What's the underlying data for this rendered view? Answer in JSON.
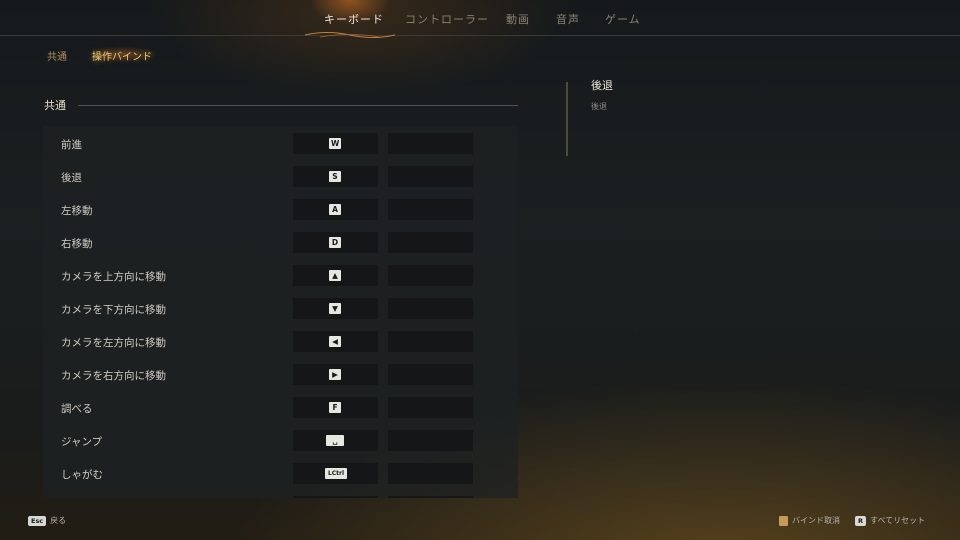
{
  "topnav": {
    "tabs": [
      {
        "label": "キーボード",
        "active": true
      },
      {
        "label": "コントローラー",
        "active": false
      },
      {
        "label": "動画",
        "active": false
      },
      {
        "label": "音声",
        "active": false
      },
      {
        "label": "ゲーム",
        "active": false
      }
    ]
  },
  "subtabs": [
    {
      "label": "共通",
      "active": false
    },
    {
      "label": "操作バインド",
      "active": true
    }
  ],
  "section": {
    "title": "共通"
  },
  "bindings": [
    {
      "action": "前進",
      "primary": "W",
      "secondary": ""
    },
    {
      "action": "後退",
      "primary": "S",
      "secondary": ""
    },
    {
      "action": "左移動",
      "primary": "A",
      "secondary": ""
    },
    {
      "action": "右移動",
      "primary": "D",
      "secondary": ""
    },
    {
      "action": "カメラを上方向に移動",
      "primary": "▲",
      "secondary": ""
    },
    {
      "action": "カメラを下方向に移動",
      "primary": "▼",
      "secondary": ""
    },
    {
      "action": "カメラを左方向に移動",
      "primary": "◀",
      "secondary": ""
    },
    {
      "action": "カメラを右方向に移動",
      "primary": "▶",
      "secondary": ""
    },
    {
      "action": "調べる",
      "primary": "F",
      "secondary": ""
    },
    {
      "action": "ジャンプ",
      "primary": "␣",
      "secondary": ""
    },
    {
      "action": "しゃがむ",
      "primary": "LCtrl",
      "secondary": ""
    }
  ],
  "detail": {
    "title": "後退",
    "description": "後退"
  },
  "hints": {
    "back_key": "Esc",
    "back_label": "戻る",
    "unbind_label": "バインド取消",
    "reset_key": "R",
    "reset_label": "すべてリセット"
  },
  "colors": {
    "accent": "#f0c878",
    "panel": "#1e2223",
    "slot": "#141617"
  }
}
